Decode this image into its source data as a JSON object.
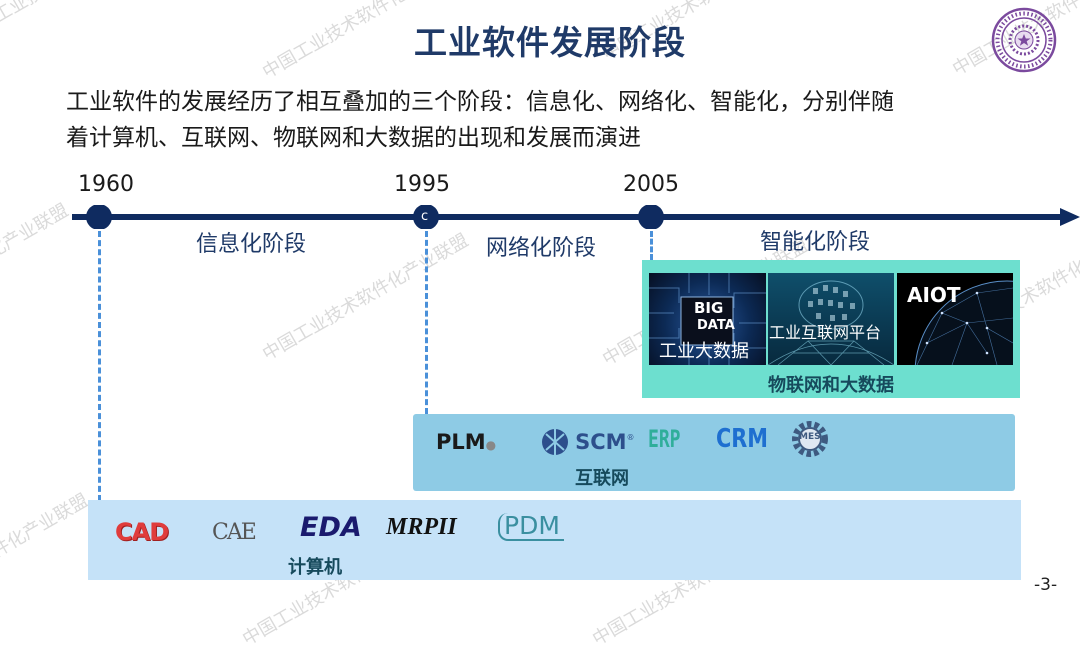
{
  "slide": {
    "title": "工业软件发展阶段",
    "intro_line1": "工业软件的发展经历了相互叠加的三个阶段：信息化、网络化、智能化，分别伴随",
    "intro_line2": "着计算机、互联网、物联网和大数据的出现和发展而演进",
    "page_number": "-3-"
  },
  "timeline": {
    "years": [
      "1960",
      "1995",
      "2005"
    ],
    "marker_letter": "c",
    "phases": [
      "信息化阶段",
      "网络化阶段",
      "智能化阶段"
    ]
  },
  "iot_panel": {
    "label": "物联网和大数据",
    "cards": [
      {
        "icon": "big-data-image",
        "overlay_top": "BIG",
        "overlay_mid": "DATA",
        "caption": "工业大数据"
      },
      {
        "icon": "industrial-internet-platform-image",
        "caption": "工业互联网平台"
      },
      {
        "icon": "aiot-image",
        "caption": "AIOT"
      }
    ]
  },
  "internet_panel": {
    "label": "互联网",
    "logos": [
      {
        "text": "PLM",
        "icon": "plm-logo"
      },
      {
        "text": "SCM",
        "icon": "scm-logo"
      },
      {
        "text": "ERP",
        "icon": "erp-logo"
      },
      {
        "text": "CRM",
        "icon": "crm-logo"
      },
      {
        "text": "MES",
        "icon": "mes-gear-logo"
      }
    ]
  },
  "computer_panel": {
    "label": "计算机",
    "logos": [
      {
        "text": "CAD",
        "icon": "cad-logo"
      },
      {
        "text": "CAE",
        "icon": "cae-logo"
      },
      {
        "text": "EDA",
        "icon": "eda-logo"
      },
      {
        "text": "MRPII",
        "icon": "mrpii-logo"
      },
      {
        "text": "PDM",
        "icon": "pdm-logo"
      }
    ]
  },
  "watermark": {
    "text": "中国工业技术软件化产业联盟"
  },
  "colors": {
    "title": "#1f3a68",
    "axis": "#0f2b60",
    "dash": "#4a90d9",
    "iot_panel": "#6ddfcf",
    "internet_panel": "#8ecbe5",
    "computer_panel": "#c5e2f8",
    "panel_label": "#164a5c"
  }
}
